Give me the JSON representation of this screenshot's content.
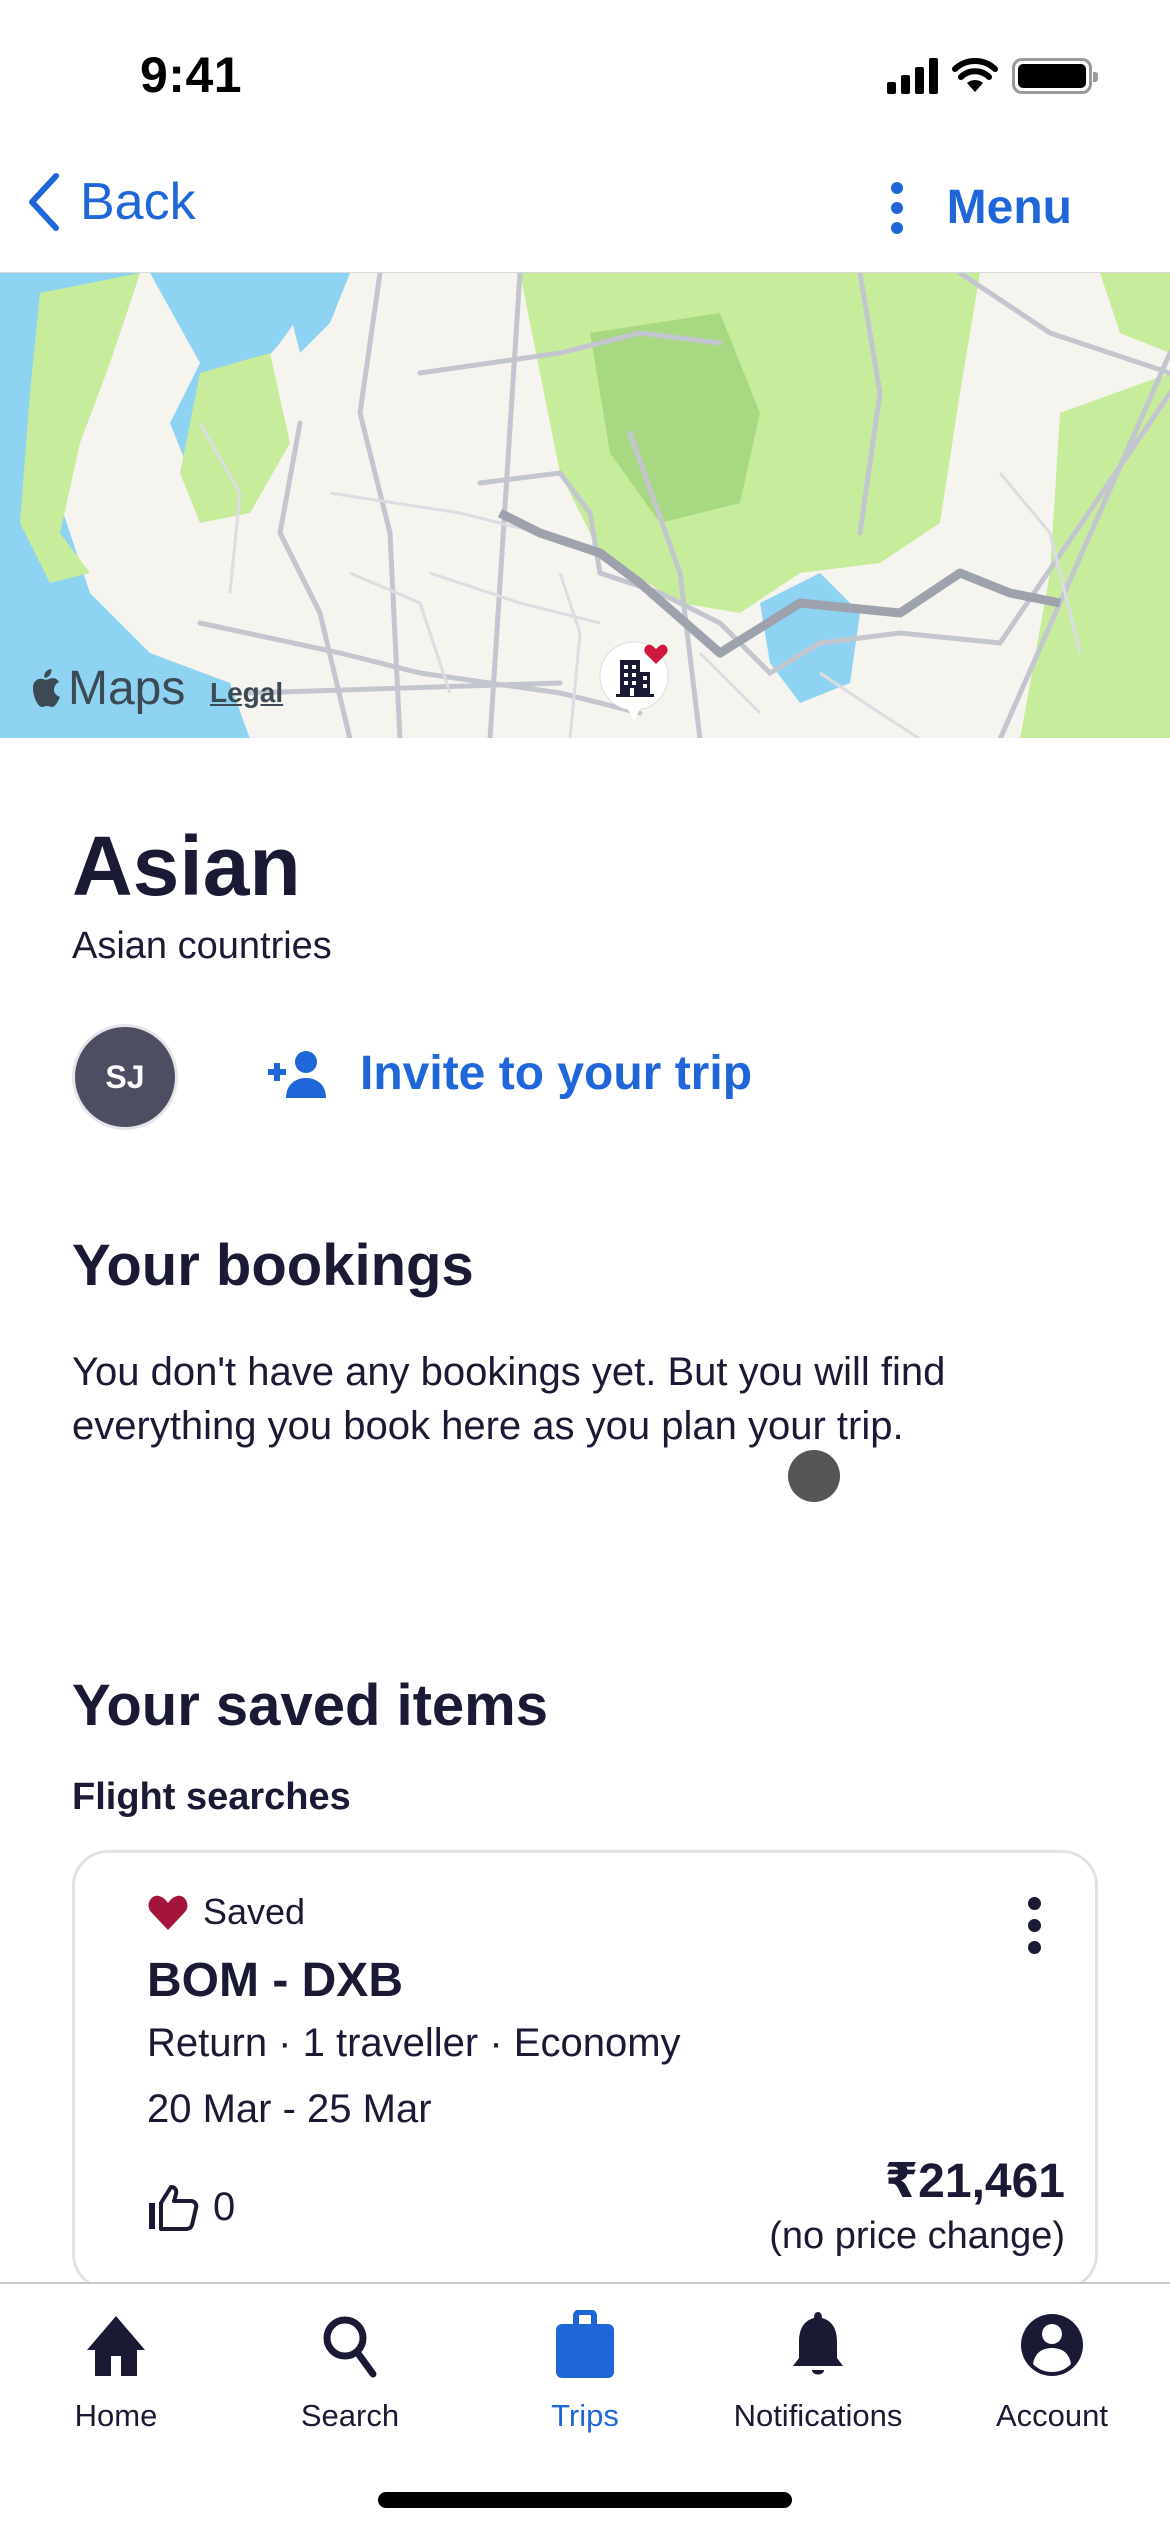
{
  "status_bar": {
    "time": "9:41"
  },
  "nav": {
    "back_label": "Back",
    "menu_label": "Menu"
  },
  "map": {
    "brand": "Maps",
    "legal": "Legal",
    "marker": "hotel-saved-marker"
  },
  "trip": {
    "title": "Asian",
    "subtitle": "Asian countries",
    "avatar_initials": "SJ",
    "invite_label": "Invite to your trip"
  },
  "bookings": {
    "heading": "Your bookings",
    "empty_text": "You don't have any bookings yet. But you will find everything you book here as you plan your trip."
  },
  "saved": {
    "heading": "Your saved items",
    "flight_searches_label": "Flight searches",
    "items": [
      {
        "status": "Saved",
        "route": "BOM - DXB",
        "details": "Return · 1 traveller · Economy",
        "dates": "20 Mar - 25 Mar",
        "likes": "0",
        "price": "₹21,461",
        "price_note": "(no price change)"
      }
    ]
  },
  "tab_bar": {
    "active": "Trips",
    "tabs": [
      {
        "label": "Home",
        "icon": "home-icon"
      },
      {
        "label": "Search",
        "icon": "search-icon"
      },
      {
        "label": "Trips",
        "icon": "suitcase-icon"
      },
      {
        "label": "Notifications",
        "icon": "bell-icon"
      },
      {
        "label": "Account",
        "icon": "account-icon"
      }
    ]
  },
  "colors": {
    "accent": "#1f66d9",
    "text": "#1a1a35",
    "heart": "#a3143c",
    "map_water": "#8fd3f2",
    "map_park": "#c7ec9c",
    "map_land": "#f6f4ef"
  }
}
